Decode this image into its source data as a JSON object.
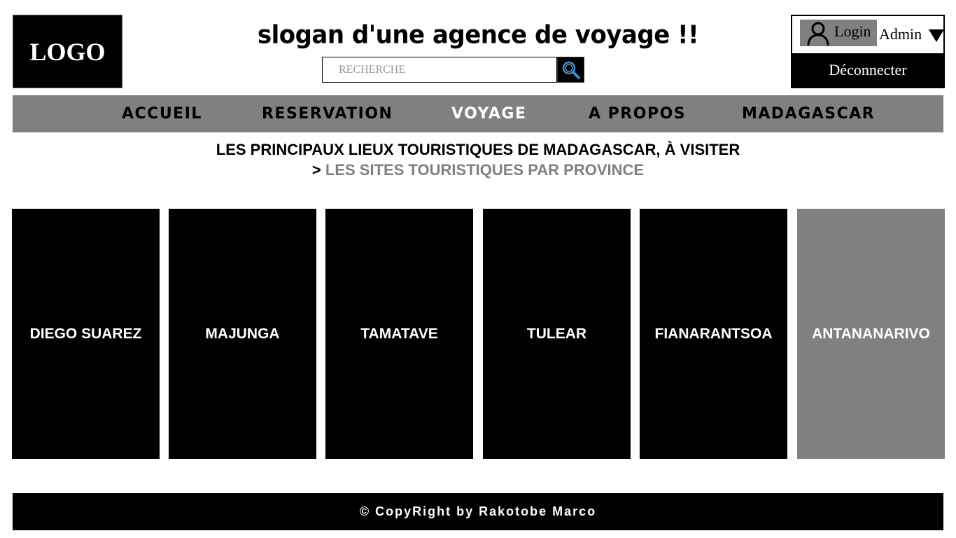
{
  "header": {
    "logo_text": "LOGO",
    "slogan": "slogan d'une agence de voyage !!",
    "search": {
      "placeholder": "RECHERCHE",
      "value": "",
      "button_icon": "search-icon"
    }
  },
  "user_panel": {
    "login_label": "Login",
    "user_name": "Admin",
    "logout_label": "Déconnecter",
    "icons": [
      "user-icon",
      "caret-down-icon"
    ]
  },
  "nav": {
    "items": [
      {
        "label": "ACCUEIL",
        "active": false
      },
      {
        "label": "RESERVATION",
        "active": false
      },
      {
        "label": "VOYAGE",
        "active": true
      },
      {
        "label": "A PROPOS",
        "active": false
      },
      {
        "label": "MADAGASCAR",
        "active": false
      }
    ]
  },
  "main": {
    "title": "LES PRINCIPAUX LIEUX TOURISTIQUES DE MADAGASCAR, À VISITER",
    "breadcrumb_sep": ">",
    "breadcrumb_link": "LES SITES TOURISTIQUES PAR PROVINCE",
    "provinces": [
      {
        "name": "DIEGO SUAREZ",
        "highlighted": false
      },
      {
        "name": "MAJUNGA",
        "highlighted": false
      },
      {
        "name": "TAMATAVE",
        "highlighted": false
      },
      {
        "name": "TULEAR",
        "highlighted": false
      },
      {
        "name": "FIANARANTSOA",
        "highlighted": false
      },
      {
        "name": "ANTANANARIVO",
        "highlighted": true
      }
    ]
  },
  "footer": {
    "text": "© CopyRight by Rakotobe Marco"
  },
  "colors": {
    "black": "#000000",
    "gray": "#808080",
    "white": "#ffffff",
    "search_icon_accent": "#3a8fd6"
  }
}
